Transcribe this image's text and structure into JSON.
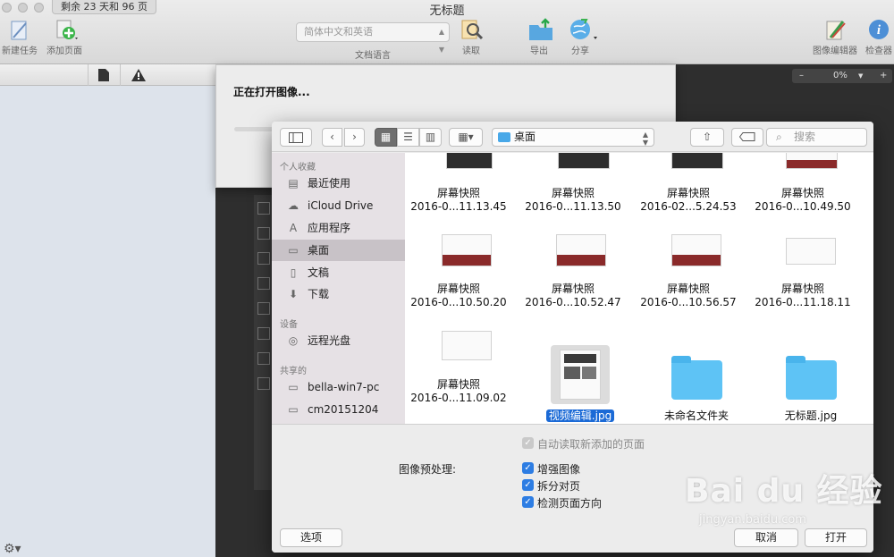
{
  "window": {
    "title": "无标题",
    "trial_badge": "剩余 23 天和 96 页"
  },
  "toolbar": {
    "new_task": "新建任务",
    "add_page": "添加页面",
    "language_select": "简体中文和英语",
    "language_label": "文档语言",
    "read": "读取",
    "export": "导出",
    "share": "分享",
    "image_editor": "图像编辑器",
    "inspector": "检查器"
  },
  "zoom": {
    "minus": "–",
    "value": "0%",
    "plus": "+"
  },
  "sheet": {
    "title": "正在打开图像..."
  },
  "dialog": {
    "location": "桌面",
    "search_placeholder": "搜索",
    "sidebar": {
      "favorites_header": "个人收藏",
      "devices_header": "设备",
      "shared_header": "共享的",
      "items": [
        {
          "label": "最近使用",
          "icon": "▤"
        },
        {
          "label": "iCloud Drive",
          "icon": "☁"
        },
        {
          "label": "应用程序",
          "icon": "A"
        },
        {
          "label": "桌面",
          "icon": "▭"
        },
        {
          "label": "文稿",
          "icon": "▯"
        },
        {
          "label": "下载",
          "icon": "⬇"
        },
        {
          "label": "远程光盘",
          "icon": "◎"
        },
        {
          "label": "bella-win7-pc",
          "icon": "▭"
        },
        {
          "label": "cm20151204",
          "icon": "▭"
        }
      ]
    },
    "files": [
      {
        "name1": "屏幕快照",
        "name2": "2016-0...11.13.45"
      },
      {
        "name1": "屏幕快照",
        "name2": "2016-0...11.13.50"
      },
      {
        "name1": "屏幕快照",
        "name2": "2016-02...5.24.53"
      },
      {
        "name1": "屏幕快照",
        "name2": "2016-0...10.49.50"
      },
      {
        "name1": "屏幕快照",
        "name2": "2016-0...10.50.20"
      },
      {
        "name1": "屏幕快照",
        "name2": "2016-0...10.52.47"
      },
      {
        "name1": "屏幕快照",
        "name2": "2016-0...10.56.57"
      },
      {
        "name1": "屏幕快照",
        "name2": "2016-0...11.18.11"
      },
      {
        "name1": "屏幕快照",
        "name2": "2016-0...11.09.02"
      },
      {
        "name1": "视频编辑.jpg",
        "name2": ""
      },
      {
        "name1": "未命名文件夹",
        "name2": ""
      },
      {
        "name1": "无标题.jpg",
        "name2": ""
      }
    ],
    "auto_read": "自动读取新添加的页面",
    "preprocess_label": "图像预处理:",
    "enhance": "增强图像",
    "split": "拆分对页",
    "detect_orientation": "检测页面方向",
    "options_button": "选项",
    "cancel_button": "取消",
    "open_button": "打开"
  },
  "watermark": {
    "brand": "Bai du 经验",
    "url": "jingyan.baidu.com"
  },
  "colors": {
    "accent": "#2d7de3",
    "selection": "#1b6ad6",
    "folder": "#5ec3f5",
    "thumb_band": "#8a2a2a"
  }
}
